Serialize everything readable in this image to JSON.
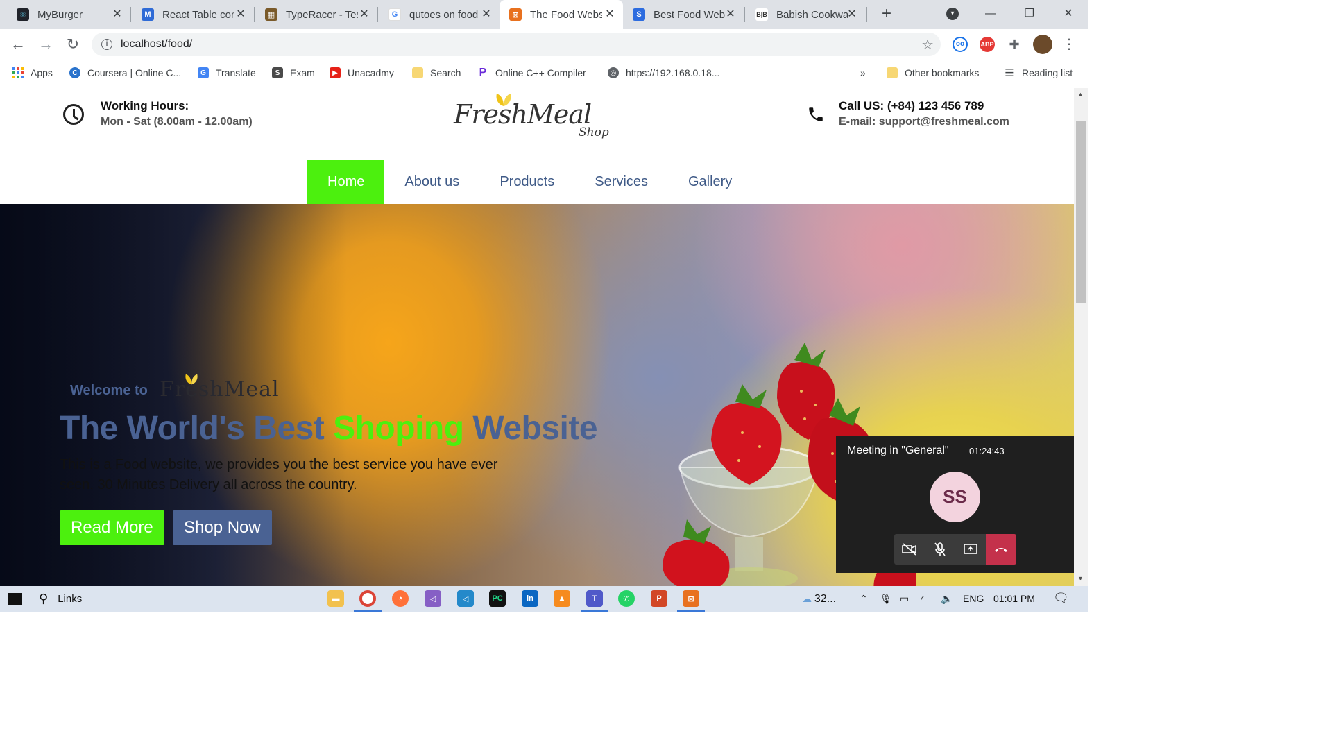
{
  "browser": {
    "tabs": [
      {
        "title": "MyBurger",
        "icon": "react-icon",
        "color": "#20232a"
      },
      {
        "title": "React Table con",
        "icon": "react-table-icon",
        "color": "#2f6bd6"
      },
      {
        "title": "TypeRacer - Tes",
        "icon": "typeracer-icon",
        "color": "#7a5a2a"
      },
      {
        "title": "qutoes on food",
        "icon": "google-icon",
        "color": "#4285f4"
      },
      {
        "title": "The Food Webs",
        "icon": "xampp-icon",
        "color": "#e8711f"
      },
      {
        "title": "Best Food Web",
        "icon": "s-icon",
        "color": "#2d6cdf"
      },
      {
        "title": "Babish Cookwa",
        "icon": "babish-icon",
        "color": "#333333"
      }
    ],
    "active_tab": 4,
    "url": "localhost/food/",
    "bookmarks": [
      {
        "label": "Apps"
      },
      {
        "label": "Coursera | Online C..."
      },
      {
        "label": "Translate"
      },
      {
        "label": "Exam"
      },
      {
        "label": "Unacadmy"
      },
      {
        "label": "Search"
      },
      {
        "label": "Online C++ Compiler"
      },
      {
        "label": "https://192.168.0.18..."
      }
    ],
    "bookmarks_overflow": "»",
    "other_bookmarks": "Other bookmarks",
    "reading_list": "Reading list",
    "extensions": {
      "abp": "ABP"
    }
  },
  "site": {
    "working_hours_label": "Working Hours:",
    "working_hours_value": "Mon - Sat (8.00am - 12.00am)",
    "logo_main": "FreshMeal",
    "logo_sub": "Shop",
    "call_label": "Call US: (+84) 123 456 789",
    "email_value": "E-mail: support@freshmeal.com",
    "nav": [
      "Home",
      "About us",
      "Products",
      "Services",
      "Gallery"
    ],
    "nav_active": "Home",
    "hero": {
      "welcome": "Welcome to",
      "welcome_logo": "FreshMeal",
      "headline_part1": "The World's Best ",
      "headline_part2": "Shoping",
      "headline_part3": " Website",
      "subtext": "This is a Food website, we provides you the best service you have ever seen. 30 Minutes Delivery all across the country.",
      "btn_read": "Read More",
      "btn_shop": "Shop Now"
    },
    "colors": {
      "accent_green": "#4cf00e",
      "brand_blue": "#4a6293"
    }
  },
  "meeting": {
    "title": "Meeting in \"General\"",
    "elapsed": "01:24:43",
    "minimize": "_",
    "avatar_initials": "SS"
  },
  "taskbar": {
    "search_label": "Links",
    "weather": "32...",
    "language": "ENG",
    "time": "01:01 PM"
  }
}
